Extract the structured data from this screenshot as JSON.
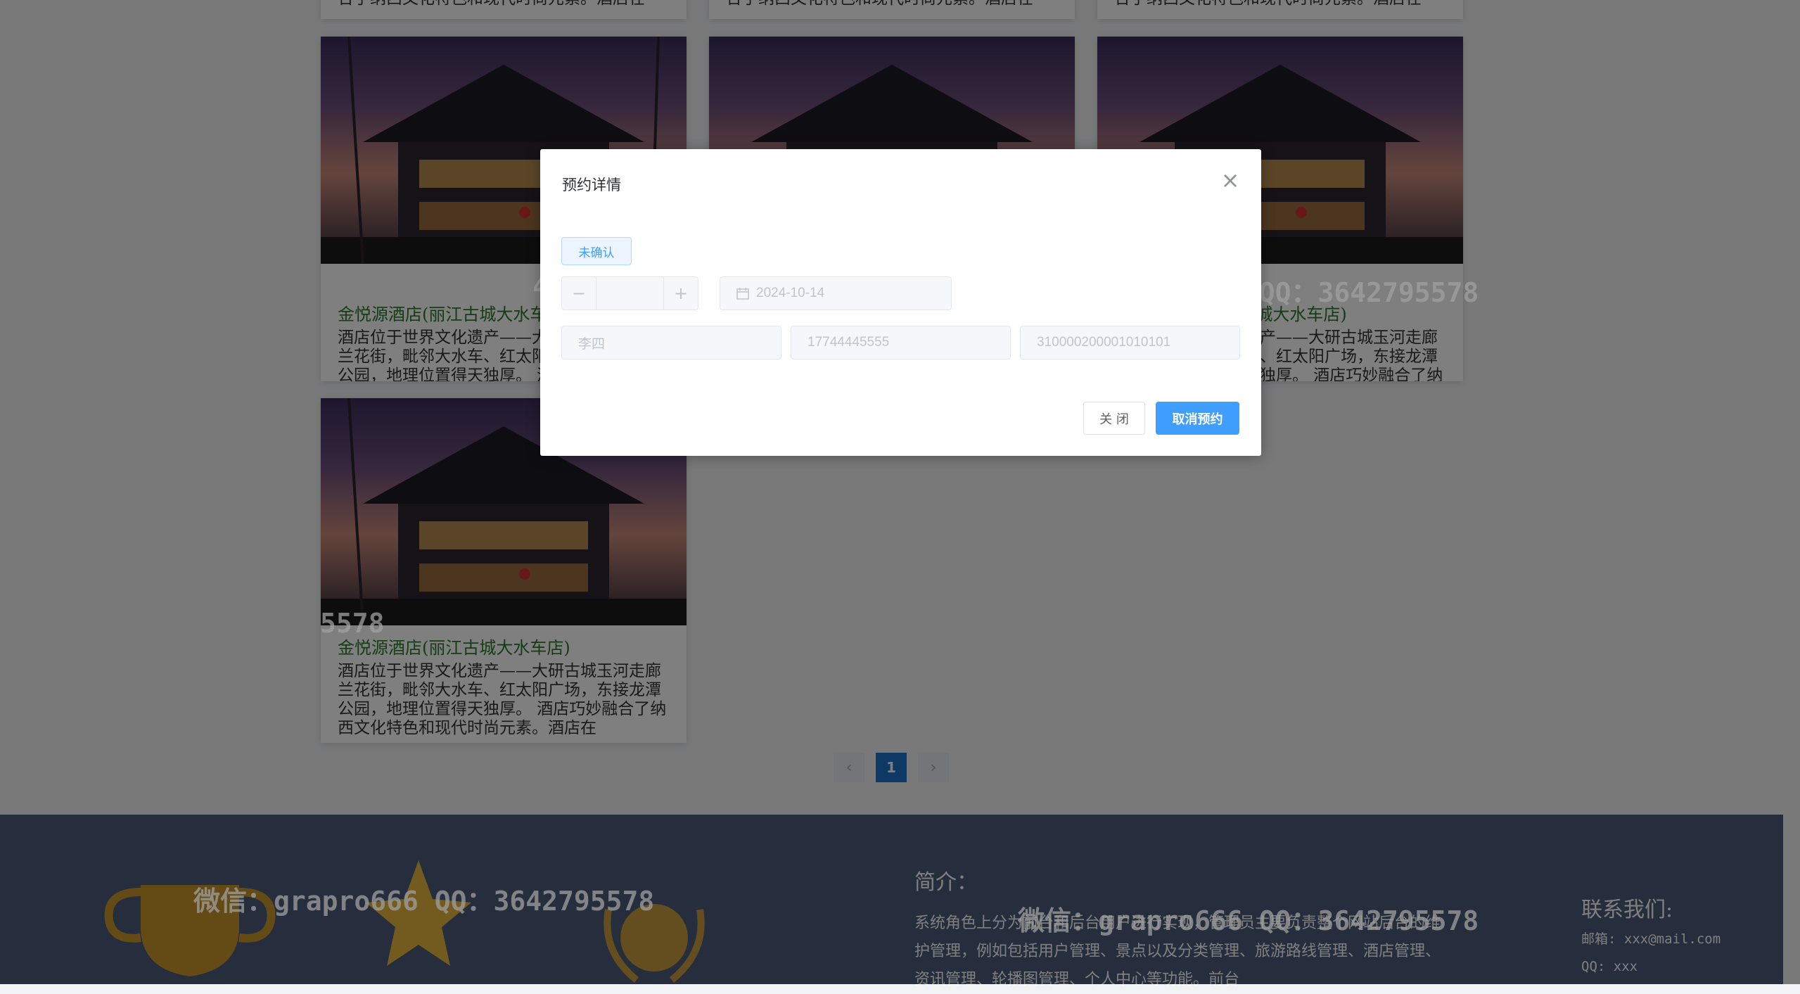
{
  "hotel": {
    "name": "金悦源酒店(丽江古城大水车店)",
    "desc": "酒店位于世界文化遗产——大研古城玉河走廊兰花街，毗邻大水车、红太阳广场，东接龙潭公园，地理位置得天独厚。 酒店巧妙融合了纳西文化特色和现代时尚元素。酒店在",
    "desc_tail": "合了纳西文化特色和现代时尚元素。酒店在"
  },
  "pagination": {
    "prev": "‹",
    "current": "1",
    "next": "›"
  },
  "footer": {
    "intro_title": "简介：",
    "intro_text": "系统角色上分为前台和后台用户进行实现，管理员主要负责整个网站后台的维护管理，例如包括用户管理、景点以及分类管理、旅游路线管理、酒店管理、资讯管理、轮播图管理、个人中心等功能。前台",
    "contact_title": "联系我们:",
    "email": "邮箱: xxx@mail.com",
    "qq": "QQ: xxx"
  },
  "watermark": {
    "text": "微信：grapro666 QQ：3642795578",
    "fragment_a": "42795578",
    "fragment_b": "5578"
  },
  "dialog": {
    "title": "预约详情",
    "close_symbol": "×",
    "status_tag": "未确认",
    "stepper": {
      "minus": "−",
      "plus": "+",
      "value": ""
    },
    "date": "2024-10-14",
    "name": "李四",
    "phone": "17744445555",
    "id_number": "310000200001010101",
    "close_button": "关 闭",
    "cancel_button": "取消预约"
  },
  "colors": {
    "primary": "#409eff",
    "footer_bg": "#4d5d7a",
    "tag_bg": "#ecf5ff",
    "active_page": "#1a73c9"
  }
}
